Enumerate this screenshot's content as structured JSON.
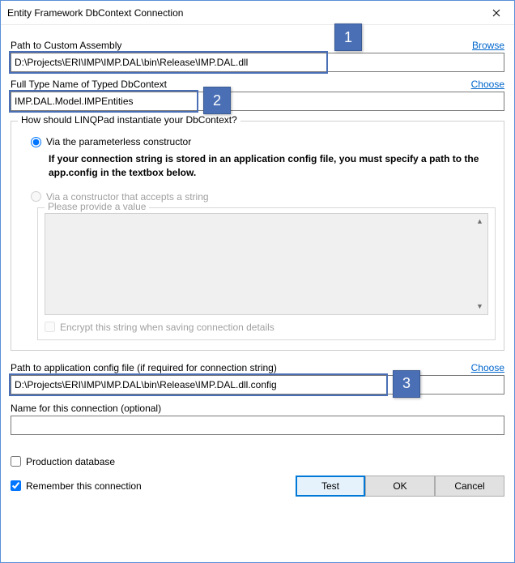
{
  "window": {
    "title": "Entity Framework DbContext Connection"
  },
  "callouts": {
    "one": "1",
    "two": "2",
    "three": "3"
  },
  "assembly": {
    "label": "Path to Custom Assembly",
    "link": "Browse",
    "value": "D:\\Projects\\ERI\\IMP\\IMP.DAL\\bin\\Release\\IMP.DAL.dll"
  },
  "typename": {
    "label": "Full Type Name of Typed DbContext",
    "link": "Choose",
    "value": "IMP.DAL.Model.IMPEntities"
  },
  "instantiate": {
    "legend": "How should LINQPad instantiate your DbContext?",
    "radio1": "Via the parameterless constructor",
    "note": "If your connection string is stored in an application config file, you must specify a path to the app.config in the textbox below.",
    "radio2": "Via a constructor that accepts a string",
    "inner_legend": "Please provide a value",
    "encrypt": "Encrypt this string when saving connection details"
  },
  "configpath": {
    "label": "Path to application config file (if required for connection string)",
    "link": "Choose",
    "value": "D:\\Projects\\ERI\\IMP\\IMP.DAL\\bin\\Release\\IMP.DAL.dll.config"
  },
  "connname": {
    "label": "Name for this connection (optional)",
    "value": ""
  },
  "checks": {
    "production": "Production database",
    "remember": "Remember this connection"
  },
  "buttons": {
    "test": "Test",
    "ok": "OK",
    "cancel": "Cancel"
  }
}
